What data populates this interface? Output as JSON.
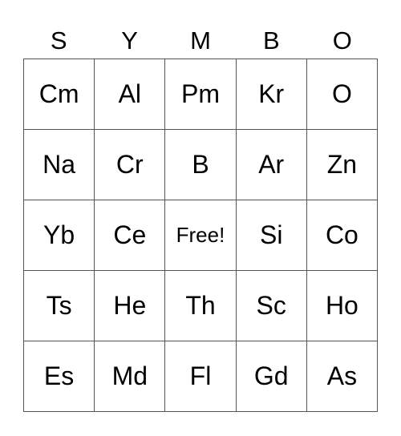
{
  "header": [
    "S",
    "Y",
    "M",
    "B",
    "O"
  ],
  "rows": [
    [
      "Cm",
      "Al",
      "Pm",
      "Kr",
      "O"
    ],
    [
      "Na",
      "Cr",
      "B",
      "Ar",
      "Zn"
    ],
    [
      "Yb",
      "Ce",
      "Free!",
      "Si",
      "Co"
    ],
    [
      "Ts",
      "He",
      "Th",
      "Sc",
      "Ho"
    ],
    [
      "Es",
      "Md",
      "Fl",
      "Gd",
      "As"
    ]
  ]
}
